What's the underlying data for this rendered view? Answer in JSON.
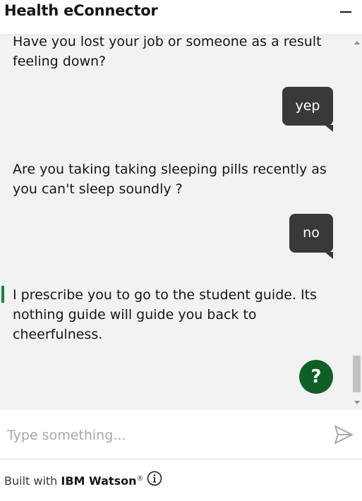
{
  "header": {
    "title": "Health eConnector",
    "minimize_icon": "minimize-icon"
  },
  "conversation": {
    "bot_msg_1": "Have you lost your job or someone as a result feeling down?",
    "user_msg_1": "yep",
    "bot_msg_2": "Are you taking taking sleeping pills recently as you can't sleep soundly ?",
    "user_msg_2": "no",
    "bot_msg_3": "I prescribe you to go to the student guide. Its nothing guide will guide you back to cheerfulness.",
    "help_label": "?"
  },
  "input": {
    "placeholder": "Type something...",
    "value": ""
  },
  "footer": {
    "built_with": "Built with ",
    "brand": "IBM Watson",
    "reg": "®"
  },
  "colors": {
    "bubble": "#393939",
    "accent": "#198038",
    "help_button": "#0e6027",
    "chat_bg": "#f2f2f2"
  }
}
